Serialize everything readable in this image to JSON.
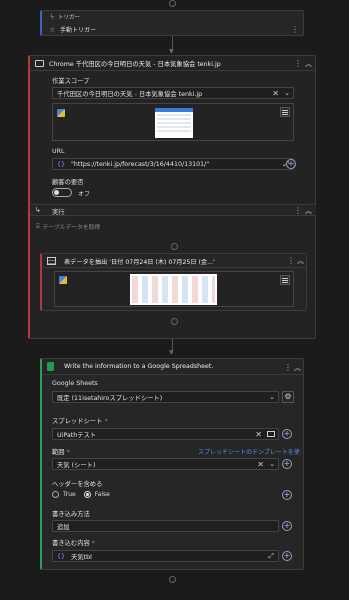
{
  "trigger": {
    "section_label": "トリガー",
    "manual_label": "手動トリガー"
  },
  "browser": {
    "title": "Chrome 千代田区の今日明日の天気 - 日本気象協会 tenki.jp",
    "scope_label": "作業スコープ",
    "scope_value": "千代田区の今日明日の天気 - 日本気象協会 tenki.jp",
    "url_label": "URL",
    "url_value": "\"https://tenki.jp/forecast/3/16/4410/13101/\"",
    "mobile_label": "顧客の要否",
    "toggle_label": "オフ"
  },
  "execute": {
    "title": "実行",
    "placeholder": "テーブルデータを取得"
  },
  "extract": {
    "title": "表データを抽出 '日付 07月24日 (木) 07月25日 (金...'"
  },
  "sheets": {
    "title": "Write the information to a Google Spreadsheet.",
    "google_sheets_label": "Google Sheets",
    "account_value": "既定 (11isetahiroスプレッドシート)",
    "spreadsheet_label": "スプレッドシート",
    "spreadsheet_value": "UiPathテスト",
    "range_label": "範囲",
    "range_link": "スプレッドシートのテンプレートを使用",
    "range_value": "天気 (シート)",
    "header_label": "ヘッダーを含める",
    "true_label": "True",
    "false_label": "False",
    "write_method_label": "書き込み方法",
    "write_method_value": "追加",
    "content_label": "書き込む内容",
    "content_value": "天気tbl"
  },
  "colors": {
    "accent_blue": "#3d62c9",
    "accent_red": "#b33a3a",
    "background": "#1b1b1b"
  }
}
